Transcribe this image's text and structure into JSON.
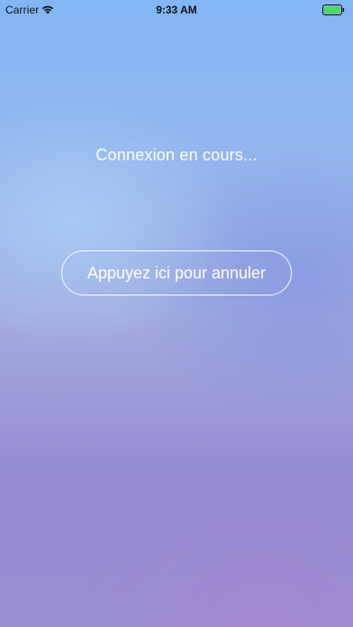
{
  "status_bar": {
    "carrier": "Carrier",
    "time": "9:33 AM",
    "wifi_icon": "wifi-icon",
    "battery_icon": "battery-icon",
    "battery_color": "#4cd964"
  },
  "main": {
    "status_text": "Connexion en cours...",
    "cancel_button_label": "Appuyez ici pour annuler"
  },
  "colors": {
    "text": "#ffffff",
    "background_top": "#82b6f5",
    "background_bottom": "#9a8ed2"
  }
}
